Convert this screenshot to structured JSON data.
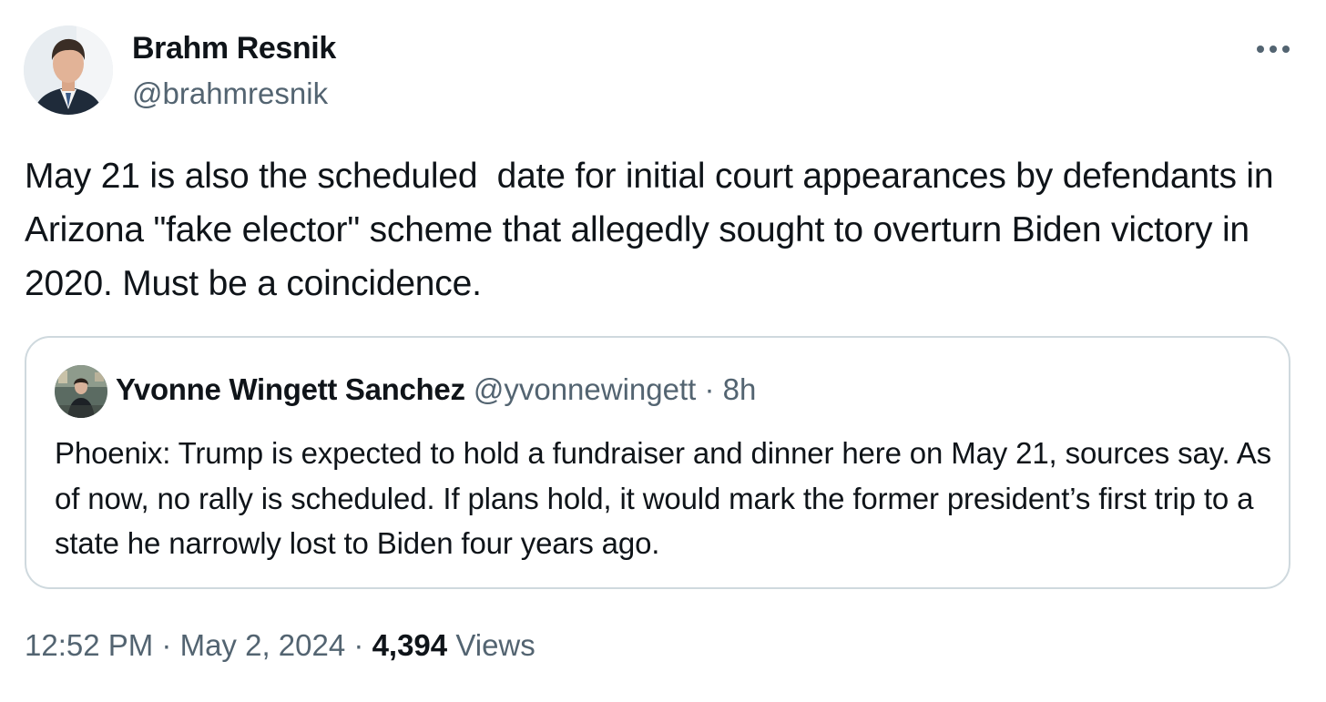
{
  "author": {
    "name": "Brahm Resnik",
    "handle": "@brahmresnik"
  },
  "more_icon": "more-horizontal-icon",
  "tweet": {
    "text": "May 21 is also the scheduled  date for initial court appearances by defendants in Arizona \"fake elector\" scheme that allegedly sought to overturn Biden victory in 2020. Must be a coincidence."
  },
  "quote": {
    "name": "Yvonne Wingett Sanchez",
    "handle": "@yvonnewingett",
    "separator": "·",
    "time": "8h",
    "text": "Phoenix: Trump is expected to hold a fundraiser and dinner here on May 21, sources say. As of now, no rally is scheduled. If plans hold, it would mark the former president’s first trip to a state he narrowly lost to Biden four years ago."
  },
  "meta": {
    "time": "12:52 PM",
    "separator": "·",
    "date": "May 2, 2024",
    "views_count": "4,394",
    "views_label": "Views"
  },
  "colors": {
    "text": "#0f1419",
    "secondary": "#536471",
    "border": "#cfd9de"
  }
}
